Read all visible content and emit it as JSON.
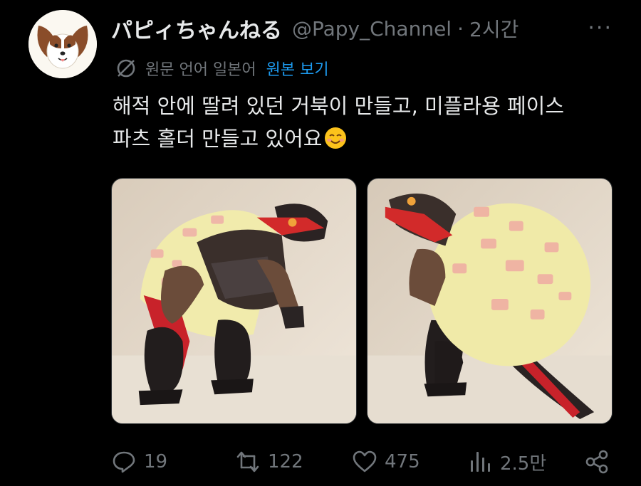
{
  "author": {
    "display_name": "パピィちゃんねる",
    "handle": "@Papy_Channel",
    "separator": "·",
    "time": "2시간",
    "more_label": "···"
  },
  "translation": {
    "icon": "translate-icon",
    "text": "원문 언어 일본어",
    "view_original": "원본 보기"
  },
  "tweet": {
    "line1": "해적 안에 딸려 있던 거북이 만들고, 미플라용 페이스",
    "line2": "파츠 홀더 만들고 있어요",
    "emoji": "smiling-face-emoji"
  },
  "media": {
    "count": 2,
    "photos": [
      {
        "subject": "turtle-figure-front-view"
      },
      {
        "subject": "turtle-figure-side-view"
      }
    ]
  },
  "actions": {
    "reply_count": "19",
    "retweet_count": "122",
    "like_count": "475",
    "views_count": "2.5만"
  },
  "colors": {
    "background": "#000000",
    "text": "#e7e9ea",
    "secondary": "#71767b",
    "link": "#1d9bf0"
  }
}
